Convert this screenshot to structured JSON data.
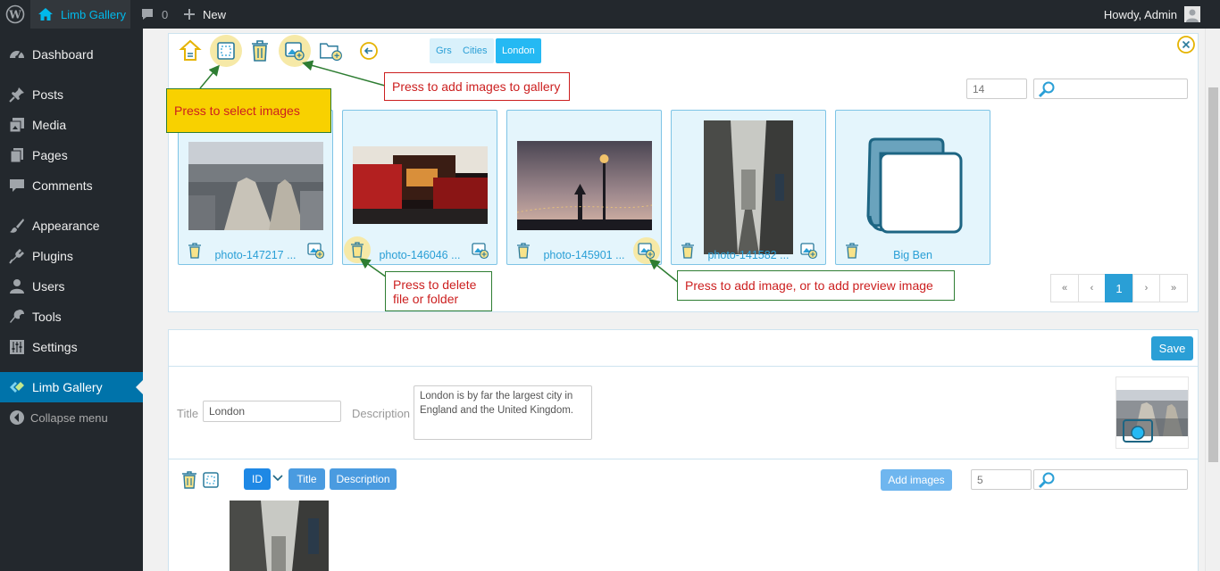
{
  "adminbar": {
    "site_name": "Limb Gallery",
    "comments_count": "0",
    "new_label": "New",
    "howdy": "Howdy, Admin"
  },
  "sidebar": {
    "items": [
      {
        "label": "Dashboard",
        "icon": "dashboard-icon"
      },
      {
        "label": "Posts",
        "icon": "pin-icon"
      },
      {
        "label": "Media",
        "icon": "media-icon"
      },
      {
        "label": "Pages",
        "icon": "pages-icon"
      },
      {
        "label": "Comments",
        "icon": "comment-icon"
      },
      {
        "label": "Appearance",
        "icon": "brush-icon"
      },
      {
        "label": "Plugins",
        "icon": "plugin-icon"
      },
      {
        "label": "Users",
        "icon": "user-icon"
      },
      {
        "label": "Tools",
        "icon": "wrench-icon"
      },
      {
        "label": "Settings",
        "icon": "settings-icon"
      },
      {
        "label": "Limb Gallery",
        "icon": "limb-icon"
      }
    ],
    "collapse_label": "Collapse menu"
  },
  "browser": {
    "breadcrumbs": [
      "Grs",
      "Cities",
      "London"
    ],
    "count_value": "14",
    "cards": [
      {
        "caption": "photo-147217 ..."
      },
      {
        "caption": "photo-146046 ..."
      },
      {
        "caption": "photo-145901 ..."
      },
      {
        "caption": "photo-141582 ..."
      },
      {
        "caption": "Big Ben"
      }
    ],
    "pagination": [
      "«",
      "‹",
      "1",
      "›",
      "»"
    ]
  },
  "callouts": {
    "select": "Press to select images",
    "add_gallery": "Press to add images to gallery",
    "delete_line1": "Press to delete",
    "delete_line2": "file or folder",
    "add_image": "Press to add image, or to add preview image"
  },
  "editor": {
    "save_label": "Save",
    "title_label": "Title",
    "title_value": "London",
    "description_label": "Description",
    "description_value": "London is by far the largest city in England and the United Kingdom."
  },
  "images_bar": {
    "sort_id": "ID",
    "sort_title": "Title",
    "sort_description": "Description",
    "add_images_label": "Add images",
    "count_value": "5"
  },
  "colors": {
    "accent": "#2a9fd6",
    "active_menu": "#0073aa",
    "callout_red": "#cc1f1f",
    "callout_green": "#2e7d32",
    "callout_yellow": "#f8d100"
  }
}
